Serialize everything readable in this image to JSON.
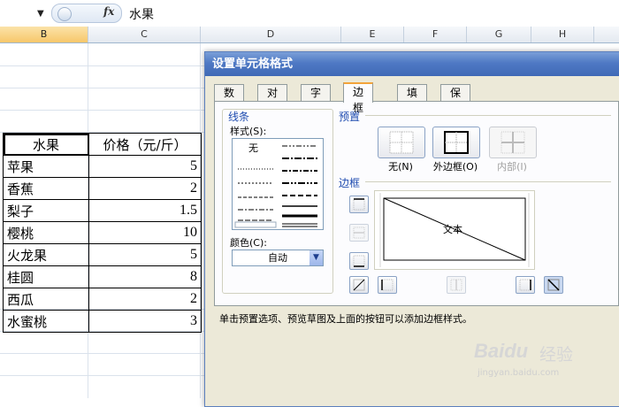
{
  "formula_bar": {
    "fx_label": "fx",
    "value": "水果"
  },
  "columns": [
    "B",
    "C",
    "D",
    "E",
    "F",
    "G",
    "H"
  ],
  "table": {
    "headers": [
      "水果",
      "价格（元/斤）"
    ],
    "rows": [
      {
        "name": "苹果",
        "price": "5"
      },
      {
        "name": "香蕉",
        "price": "2"
      },
      {
        "name": "梨子",
        "price": "1.5"
      },
      {
        "name": "樱桃",
        "price": "10"
      },
      {
        "name": "火龙果",
        "price": "5"
      },
      {
        "name": "桂圆",
        "price": "8"
      },
      {
        "name": "西瓜",
        "price": "2"
      },
      {
        "name": "水蜜桃",
        "price": "3"
      }
    ]
  },
  "dialog": {
    "title": "设置单元格格式",
    "tabs": [
      "数字",
      "对齐",
      "字体",
      "边框",
      "填充",
      "保护"
    ],
    "active_tab": "边框",
    "line_group": {
      "title": "线条",
      "style_label": "样式(S):",
      "none_label": "无",
      "color_label": "颜色(C):",
      "color_value": "自动"
    },
    "preset_group": {
      "title": "预置",
      "none": "无(N)",
      "outline": "外边框(O)",
      "inside": "内部(I)"
    },
    "border_group": {
      "title": "边框",
      "preview_text": "文本"
    },
    "hint": "单击预置选项、预览草图及上面的按钮可以添加边框样式。"
  },
  "watermark": {
    "brand": "Baidu",
    "brand_cn": "经验",
    "url": "jingyan.baidu.com"
  },
  "colors": {
    "title_bar": "#4f79c4",
    "dialog_bg": "#ece9d8",
    "accent_tab": "#f3a43b",
    "group_title": "#1f4cb0"
  }
}
